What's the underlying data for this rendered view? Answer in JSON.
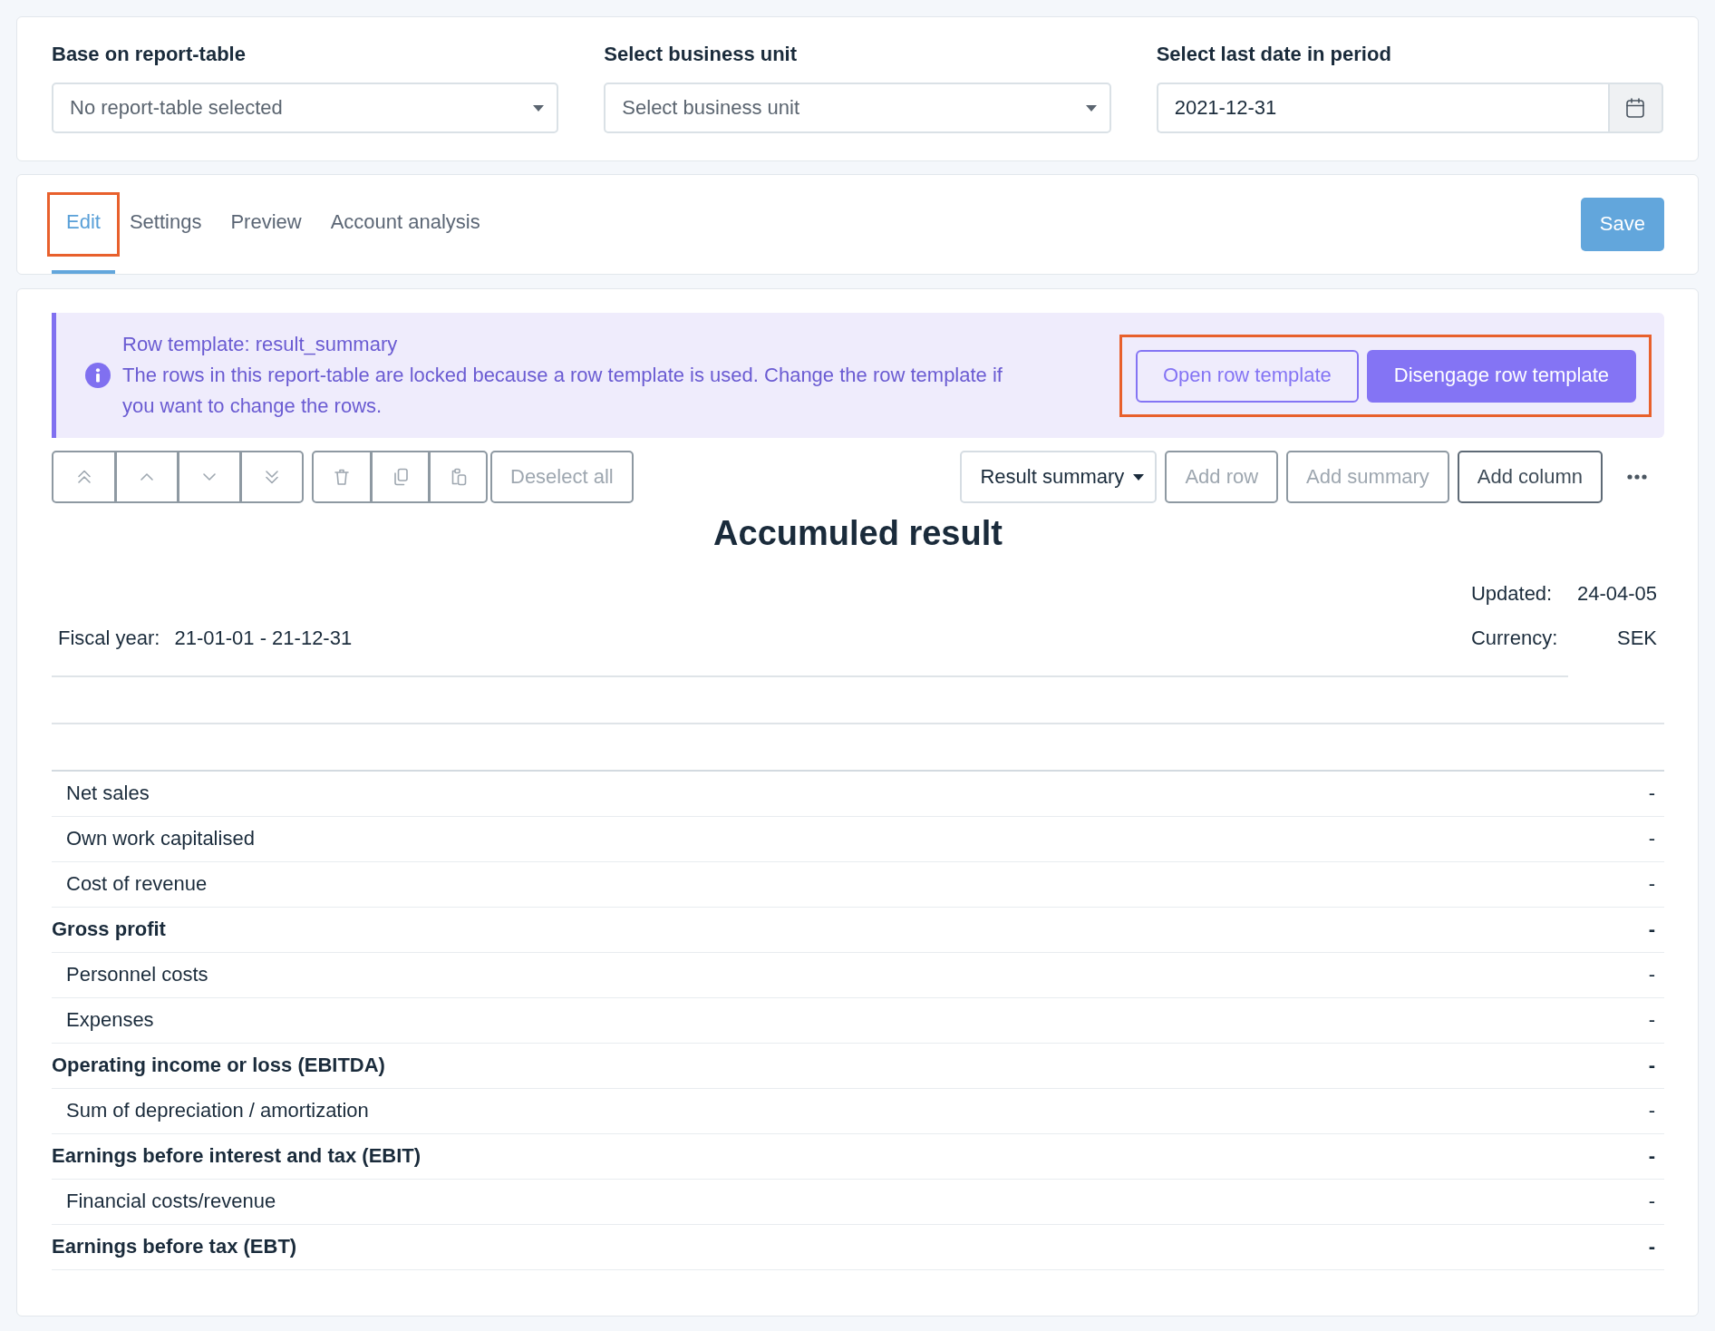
{
  "filters": [
    {
      "kind": "select",
      "label": "Base on report-table",
      "value": "No report-table selected"
    },
    {
      "kind": "select",
      "label": "Select business unit",
      "value": "Select business unit"
    },
    {
      "kind": "date",
      "label": "Select last date in period",
      "value": "2021-12-31"
    }
  ],
  "tabs": [
    {
      "label": "Edit",
      "selected": true,
      "highlighted": true
    },
    {
      "label": "Settings",
      "selected": false,
      "highlighted": false
    },
    {
      "label": "Preview",
      "selected": false,
      "highlighted": false
    },
    {
      "label": "Account analysis",
      "selected": false,
      "highlighted": false
    }
  ],
  "save_button": {
    "label": "Save"
  },
  "notice": {
    "title": "Row template: result_summary",
    "message": "The rows in this report-table are locked because a row template is used. Change the row template if you want to change the rows.",
    "actions_highlighted": true,
    "actions": [
      {
        "kind": "outline",
        "label": "Open row template"
      },
      {
        "kind": "solid",
        "label": "Disengage row template"
      }
    ]
  },
  "toolbar": {
    "move_buttons": [
      {
        "disabled": true
      },
      {
        "disabled": true
      },
      {
        "disabled": true
      },
      {
        "disabled": true
      }
    ],
    "edit_buttons": [
      {
        "disabled": true
      },
      {
        "disabled": true
      },
      {
        "disabled": true
      }
    ],
    "deselect": {
      "label": "Deselect all",
      "disabled": true
    },
    "row_type": {
      "value": "Result summary"
    },
    "actions": [
      {
        "label": "Add row",
        "disabled": true
      },
      {
        "label": "Add summary",
        "disabled": true
      },
      {
        "label": "Add column",
        "disabled": false
      }
    ]
  },
  "report": {
    "title": "Accumuled result",
    "updated": {
      "label": "Updated:",
      "value": "24-04-05"
    },
    "fiscal_year": {
      "label": "Fiscal year:",
      "value": "21-01-01 - 21-12-31"
    },
    "currency": {
      "label": "Currency:",
      "value": "SEK"
    },
    "rows": [
      {
        "kind": "item",
        "label": "Net sales",
        "value": "-"
      },
      {
        "kind": "item",
        "label": "Own work capitalised",
        "value": "-"
      },
      {
        "kind": "item",
        "label": "Cost of revenue",
        "value": "-"
      },
      {
        "kind": "total",
        "label": "Gross profit",
        "value": "-"
      },
      {
        "kind": "item",
        "label": "Personnel costs",
        "value": "-"
      },
      {
        "kind": "item",
        "label": "Expenses",
        "value": "-"
      },
      {
        "kind": "total",
        "label": "Operating income or loss (EBITDA)",
        "value": "-"
      },
      {
        "kind": "item",
        "label": "Sum of depreciation / amortization",
        "value": "-"
      },
      {
        "kind": "total",
        "label": "Earnings before interest and tax (EBIT)",
        "value": "-"
      },
      {
        "kind": "item",
        "label": "Financial costs/revenue",
        "value": "-"
      },
      {
        "kind": "total",
        "label": "Earnings before tax (EBT)",
        "value": "-"
      }
    ]
  }
}
